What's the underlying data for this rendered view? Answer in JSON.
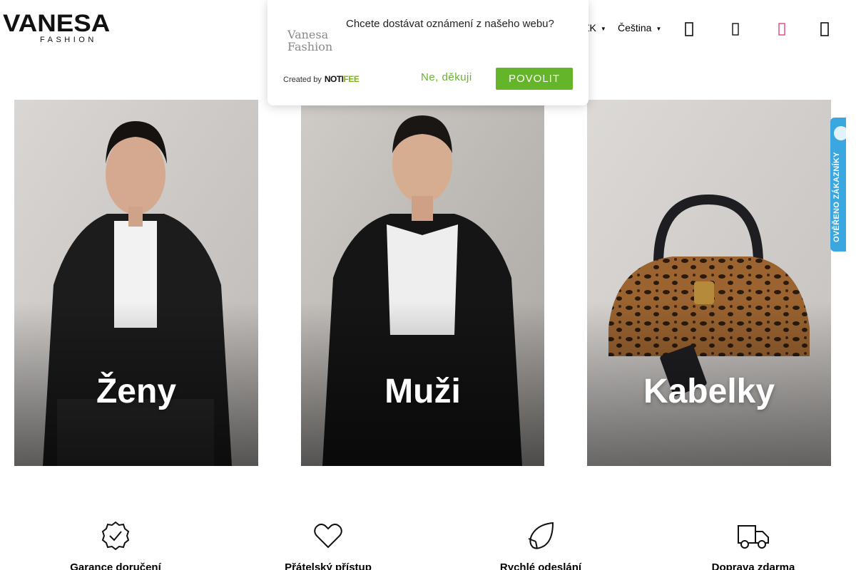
{
  "header": {
    "logo_main": "VANESA",
    "logo_sub": "FASHION",
    "currency": "CZK",
    "currency_visible": "ZK",
    "language": "Čeština",
    "icons": [
      "search-icon",
      "user-icon",
      "heart-icon",
      "cart-icon"
    ]
  },
  "notification": {
    "logo_line1": "Vanesa",
    "logo_line2": "Fashion",
    "message": "Chcete dostávat oznámení z našeho webu?",
    "created_by": "Created by",
    "brand_a": "NOTI",
    "brand_b": "FEE",
    "deny_label": "Ne, děkuji",
    "allow_label": "POVOLIT"
  },
  "categories": [
    {
      "label": "Ženy"
    },
    {
      "label": "Muži"
    },
    {
      "label": "Kabelky"
    }
  ],
  "verified_badge": {
    "text": "OVĚŘENO ZÁKAZNÍKY"
  },
  "features": [
    {
      "label": "Garance doručení",
      "icon": "badge-check-icon"
    },
    {
      "label": "Přátelský přístup",
      "icon": "heart-outline-icon"
    },
    {
      "label": "Rychlé odeslání",
      "icon": "rocket-leaf-icon"
    },
    {
      "label": "Doprava zdarma",
      "icon": "truck-icon"
    }
  ],
  "colors": {
    "accent_green": "#65b52a",
    "heart_pink": "#e0457b",
    "badge_blue": "#3ba7e0"
  }
}
